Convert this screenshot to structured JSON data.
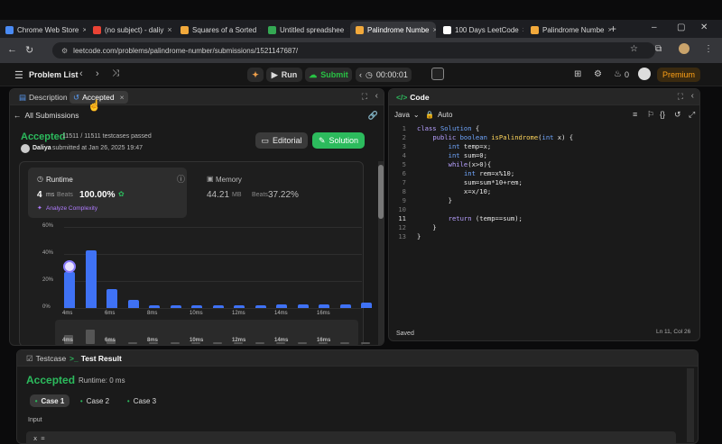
{
  "browser": {
    "tabs": [
      {
        "title": "Chrome Web Store",
        "color": "#4a8bf5",
        "left": 0,
        "width": 95
      },
      {
        "title": "(no subject) - daliy",
        "color": "#ea4335",
        "left": 97,
        "width": 95
      },
      {
        "title": "Squares of a Sorted",
        "color": "#f2a93b",
        "left": 194,
        "width": 95
      },
      {
        "title": "Untitled spreadshee",
        "color": "#34a853",
        "left": 291,
        "width": 95
      },
      {
        "title": "Palindrome Numbe",
        "color": "#f2a93b",
        "left": 388,
        "width": 95,
        "active": true
      },
      {
        "title": "100 Days LeetCode",
        "color": "#ffffff",
        "left": 485,
        "width": 95
      },
      {
        "title": "Palindrome Numbe",
        "color": "#f2a93b",
        "left": 582,
        "width": 95
      }
    ],
    "url": "leetcode.com/problems/palindrome-number/submissions/1521147687/"
  },
  "lc": {
    "problem_list": "Problem List",
    "run": "Run",
    "submit": "Submit",
    "timer": "00:00:01",
    "streak": "0",
    "premium": "Premium"
  },
  "left": {
    "tab_description": "Description",
    "tab_accepted": "Accepted",
    "all_submissions": "All Submissions",
    "status": "Accepted",
    "testcases": "11511 / 11511 testcases passed",
    "user": "Daliya",
    "submitted": "submitted at Jan 26, 2025 19:47",
    "editorial": "Editorial",
    "solution": "Solution",
    "runtime_label": "Runtime",
    "runtime_value": "4",
    "runtime_unit": "ms",
    "beats_label": "Beats",
    "runtime_beats": "100.00%",
    "analyze": "Analyze Complexity",
    "memory_label": "Memory",
    "memory_value": "44.21",
    "memory_unit": "MB",
    "memory_beats": "37.22%"
  },
  "chart_data": {
    "type": "bar",
    "y_ticks": [
      "60%",
      "40%",
      "20%",
      "0%"
    ],
    "ylim": [
      0,
      60
    ],
    "x_labels": [
      "4ms",
      "6ms",
      "8ms",
      "10ms",
      "12ms",
      "14ms",
      "16ms"
    ],
    "values": [
      27,
      43,
      14,
      6,
      2,
      2,
      2,
      2,
      2,
      2,
      3,
      3,
      3,
      3,
      4
    ]
  },
  "code_panel": {
    "title": "Code",
    "language": "Java",
    "mode": "Auto",
    "lines": [
      "class Solution {",
      "    public boolean isPalindrome(int x) {",
      "        int temp=x;",
      "        int sum=0;",
      "        while(x>0){",
      "            int rem=x%10;",
      "            sum=sum*10+rem;",
      "            x=x/10;",
      "        }",
      "",
      "        return (temp==sum);",
      "    }",
      "}"
    ],
    "saved": "Saved",
    "position": "Ln 11, Col 26"
  },
  "bottom": {
    "testcase": "Testcase",
    "test_result": "Test Result",
    "status": "Accepted",
    "runtime": "Runtime: 0 ms",
    "cases": [
      "Case 1",
      "Case 2",
      "Case 3"
    ],
    "input_label": "Input",
    "input_value": "x ="
  }
}
